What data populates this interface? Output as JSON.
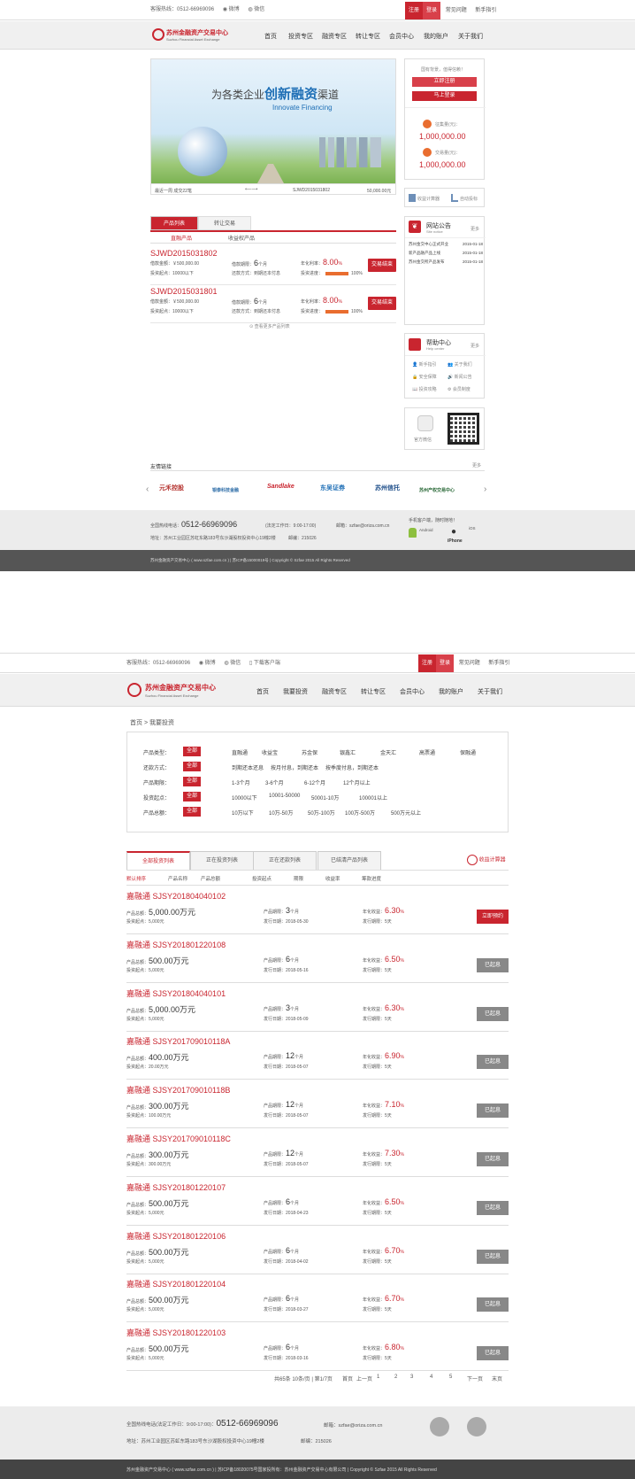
{
  "colors": {
    "accent": "#c9252f",
    "progress": "#e96d2f",
    "done_button": "#888888"
  },
  "top1": {
    "hotline": "客服热线：0512-66969096",
    "weibo": "微博",
    "wechat": "微信",
    "register": "注册",
    "login": "登录",
    "faq": "常见问题",
    "guide": "新手指引"
  },
  "logo": {
    "name": "苏州金融资产交易中心",
    "en": "Suzhou Financial Asset Exchange"
  },
  "nav1": [
    "首页",
    "投资专区",
    "融资专区",
    "转让专区",
    "会员中心",
    "我的账户",
    "关于我们"
  ],
  "banner": {
    "line1a": "为各类企业",
    "line1b": "创新融资",
    "line1c": "渠道",
    "line2": "Innovate Financing",
    "ticker_left": "最近一周 成交22笔",
    "ticker_mid": "SJWD2015031802",
    "ticker_right": "50,000.00元"
  },
  "side": {
    "welcome": "国有背景，值得信赖！",
    "register": "立即注册",
    "login": "马上登录",
    "raise_label": "征集量(元)：",
    "raise_value": "1,000,000.00",
    "deal_label": "交易量(元)：",
    "deal_value": "1,000,000.00",
    "calc": "收益计算器",
    "auto": "自动投标"
  },
  "notice": {
    "title": "网站公告",
    "sub": "Site notice",
    "more": "更多",
    "items": [
      {
        "text": "苏州金交中心正式开业",
        "date": "2015-01-18"
      },
      {
        "text": "新产品融产品上线",
        "date": "2015-01-18"
      },
      {
        "text": "苏州金交所产品发布",
        "date": "2015-01-18"
      }
    ]
  },
  "help": {
    "title": "帮助中心",
    "sub": "Help center",
    "more": "更多",
    "items": [
      "新手指引",
      "关于我们",
      "安全保障",
      "新闻公告",
      "投资攻略",
      "会员制度"
    ]
  },
  "wechat_box": {
    "label": "官方微信"
  },
  "prod_tabs": {
    "tab1": "产品列表",
    "tab2": "转让交易",
    "sub1": "直融产品",
    "sub2": "收益权产品"
  },
  "products1": [
    {
      "code": "SJWD2015031802",
      "amount": "借款金额：￥500,000.00",
      "min": "投资起点：10000以下",
      "term_label": "借款期限：",
      "term": "6",
      "term_unit": "个月",
      "repay": "还款方式：到期还本付息",
      "rate_label": "年化利率：",
      "rate": "8.00",
      "rate_unit": "%",
      "prog_label": "投资进度：",
      "prog_text": "100%",
      "progress": 1.0,
      "btn": "交易结束"
    },
    {
      "code": "SJWD2015031801",
      "amount": "借款金额：￥500,000.00",
      "min": "投资起点：10000以下",
      "term_label": "借款期限：",
      "term": "6",
      "term_unit": "个月",
      "repay": "还款方式：到期还本付息",
      "rate_label": "年化利率：",
      "rate": "8.00",
      "rate_unit": "%",
      "prog_label": "投资进度：",
      "prog_text": "100%",
      "progress": 1.0,
      "btn": "交易结束"
    }
  ],
  "more_products": "查看更多产品列表",
  "links": {
    "title": "友情链接",
    "more": "更多",
    "partners": [
      "元禾控股",
      "银泰科技金融",
      "Sandlake",
      "东吴证券",
      "苏州信托",
      "苏州产权交易中心"
    ]
  },
  "footer1": {
    "hotline_label": "全国热线电话：",
    "hotline": "0512-66969096",
    "hours": "(法定工作日：9:00-17:00)",
    "email": "邮箱：szfae@oriza.com.cn",
    "address": "地址：苏州工业园区苏虹东路183号东沙湖股权投资中心19幢2楼",
    "zip": "邮编：215026",
    "app_label": "手机客户端，随时随地！",
    "android": "Android",
    "iphone": "iPhone",
    "ios": "iOS"
  },
  "copyright1": "苏州金融资产交易中心 ( www.szfae.com.cn ) | 苏ICP备15000019号 | Copyright © Szfae 2015 All Rights Reserved",
  "top2": {
    "hotline": "客服热线：0512-66969096",
    "weibo": "微博",
    "wechat": "微信",
    "download": "下载客户端",
    "register": "注册",
    "login": "登录",
    "faq": "常见问题",
    "guide": "新手指引"
  },
  "nav2": [
    "首页",
    "我要投资",
    "融资专区",
    "转让专区",
    "会员中心",
    "我的账户",
    "关于我们"
  ],
  "breadcrumb": "首页 > 我要投资",
  "filters": [
    {
      "label": "产品类型：",
      "all": "全部",
      "opts": [
        "直融通",
        "收益宝",
        "苏金保",
        "银鑫汇",
        "金天汇",
        "高票通",
        "保融通"
      ]
    },
    {
      "label": "还款方式：",
      "all": "全部",
      "opts": [
        "到期还本还息",
        "按月付息，到期还本",
        "按季度付息，到期还本"
      ]
    },
    {
      "label": "产品期限：",
      "all": "全部",
      "opts": [
        "1-3个月",
        "3-6个月",
        "6-12个月",
        "12个月以上"
      ]
    },
    {
      "label": "投资起点：",
      "all": "全部",
      "opts": [
        "10000以下",
        "10001-50000",
        "50001-10万",
        "100001以上"
      ]
    },
    {
      "label": "产品总额：",
      "all": "全部",
      "opts": [
        "10万以下",
        "10万-50万",
        "50万-100万",
        "100万-500万",
        "500万元以上"
      ]
    }
  ],
  "list_tabs": [
    "全部投资列表",
    "正在投资列表",
    "正在还款列表",
    "已结清产品列表"
  ],
  "calc2": "收益计算器",
  "sort": [
    "默认排序",
    "产品名称",
    "产品总额",
    "投资起点",
    "期限",
    "收益率",
    "筹款进度"
  ],
  "list": [
    {
      "name": "嘉融通 SJSY201804040102",
      "total": "5,000.00万元",
      "min": "5,000元",
      "term": "3",
      "date": "2018-05-30",
      "rate": "6.30",
      "period": "5天",
      "btn": "立即预约",
      "active": true
    },
    {
      "name": "嘉融通 SJSY201801220108",
      "total": "500.00万元",
      "min": "5,000元",
      "term": "6",
      "date": "2018-05-16",
      "rate": "6.50",
      "period": "5天",
      "btn": "已起息",
      "active": false
    },
    {
      "name": "嘉融通 SJSY201804040101",
      "total": "5,000.00万元",
      "min": "5,000元",
      "term": "3",
      "date": "2018-05-09",
      "rate": "6.30",
      "period": "5天",
      "btn": "已起息",
      "active": false
    },
    {
      "name": "嘉融通 SJSY201709010118A",
      "total": "400.00万元",
      "min": "20.00万元",
      "term": "12",
      "date": "2018-05-07",
      "rate": "6.90",
      "period": "5天",
      "btn": "已起息",
      "active": false
    },
    {
      "name": "嘉融通 SJSY201709010118B",
      "total": "300.00万元",
      "min": "100.00万元",
      "term": "12",
      "date": "2018-05-07",
      "rate": "7.10",
      "period": "5天",
      "btn": "已起息",
      "active": false
    },
    {
      "name": "嘉融通 SJSY201709010118C",
      "total": "300.00万元",
      "min": "300.00万元",
      "term": "12",
      "date": "2018-05-07",
      "rate": "7.30",
      "period": "5天",
      "btn": "已起息",
      "active": false
    },
    {
      "name": "嘉融通 SJSY201801220107",
      "total": "500.00万元",
      "min": "5,000元",
      "term": "6",
      "date": "2018-04-23",
      "rate": "6.50",
      "period": "5天",
      "btn": "已起息",
      "active": false
    },
    {
      "name": "嘉融通 SJSY201801220106",
      "total": "500.00万元",
      "min": "5,000元",
      "term": "6",
      "date": "2018-04-02",
      "rate": "6.70",
      "period": "5天",
      "btn": "已起息",
      "active": false
    },
    {
      "name": "嘉融通 SJSY201801220104",
      "total": "500.00万元",
      "min": "5,000元",
      "term": "6",
      "date": "2018-03-27",
      "rate": "6.70",
      "period": "5天",
      "btn": "已起息",
      "active": false
    },
    {
      "name": "嘉融通 SJSY201801220103",
      "total": "500.00万元",
      "min": "5,000元",
      "term": "6",
      "date": "2018-03-16",
      "rate": "6.80",
      "period": "5天",
      "btn": "已起息",
      "active": false
    }
  ],
  "list_labels": {
    "total": "产品总额：",
    "min": "投资起点：",
    "term": "产品期限：",
    "term_unit": "个月",
    "date": "发行日期：",
    "rate": "年化收益：",
    "rate_unit": "%",
    "period": "发行期限："
  },
  "pager": {
    "info": "共65条 10条/页 | 第1/7页",
    "first": "首页",
    "prev": "上一页",
    "pages": [
      "1",
      "2",
      "3",
      "4",
      "5"
    ],
    "next": "下一页",
    "last": "末页"
  },
  "footer2": {
    "hotline_label": "全国热线电话",
    "hours": "(法定工作日：9:00-17:00)：",
    "hotline": "0512-66969096",
    "email": "邮箱：szfae@oriza.com.cn",
    "address": "地址：苏州工业园区苏虹东路183号东沙湖股权投资中心19幢2楼",
    "zip": "邮编：215026"
  },
  "copyright2": "苏州金融资产交易中心 ( www.szfae.com.cn ) | 苏ICP备18020075号国家投所有：苏州金融资产交易中心有限公司 | Copyright © Szfae 2015 All Rights Reserved"
}
